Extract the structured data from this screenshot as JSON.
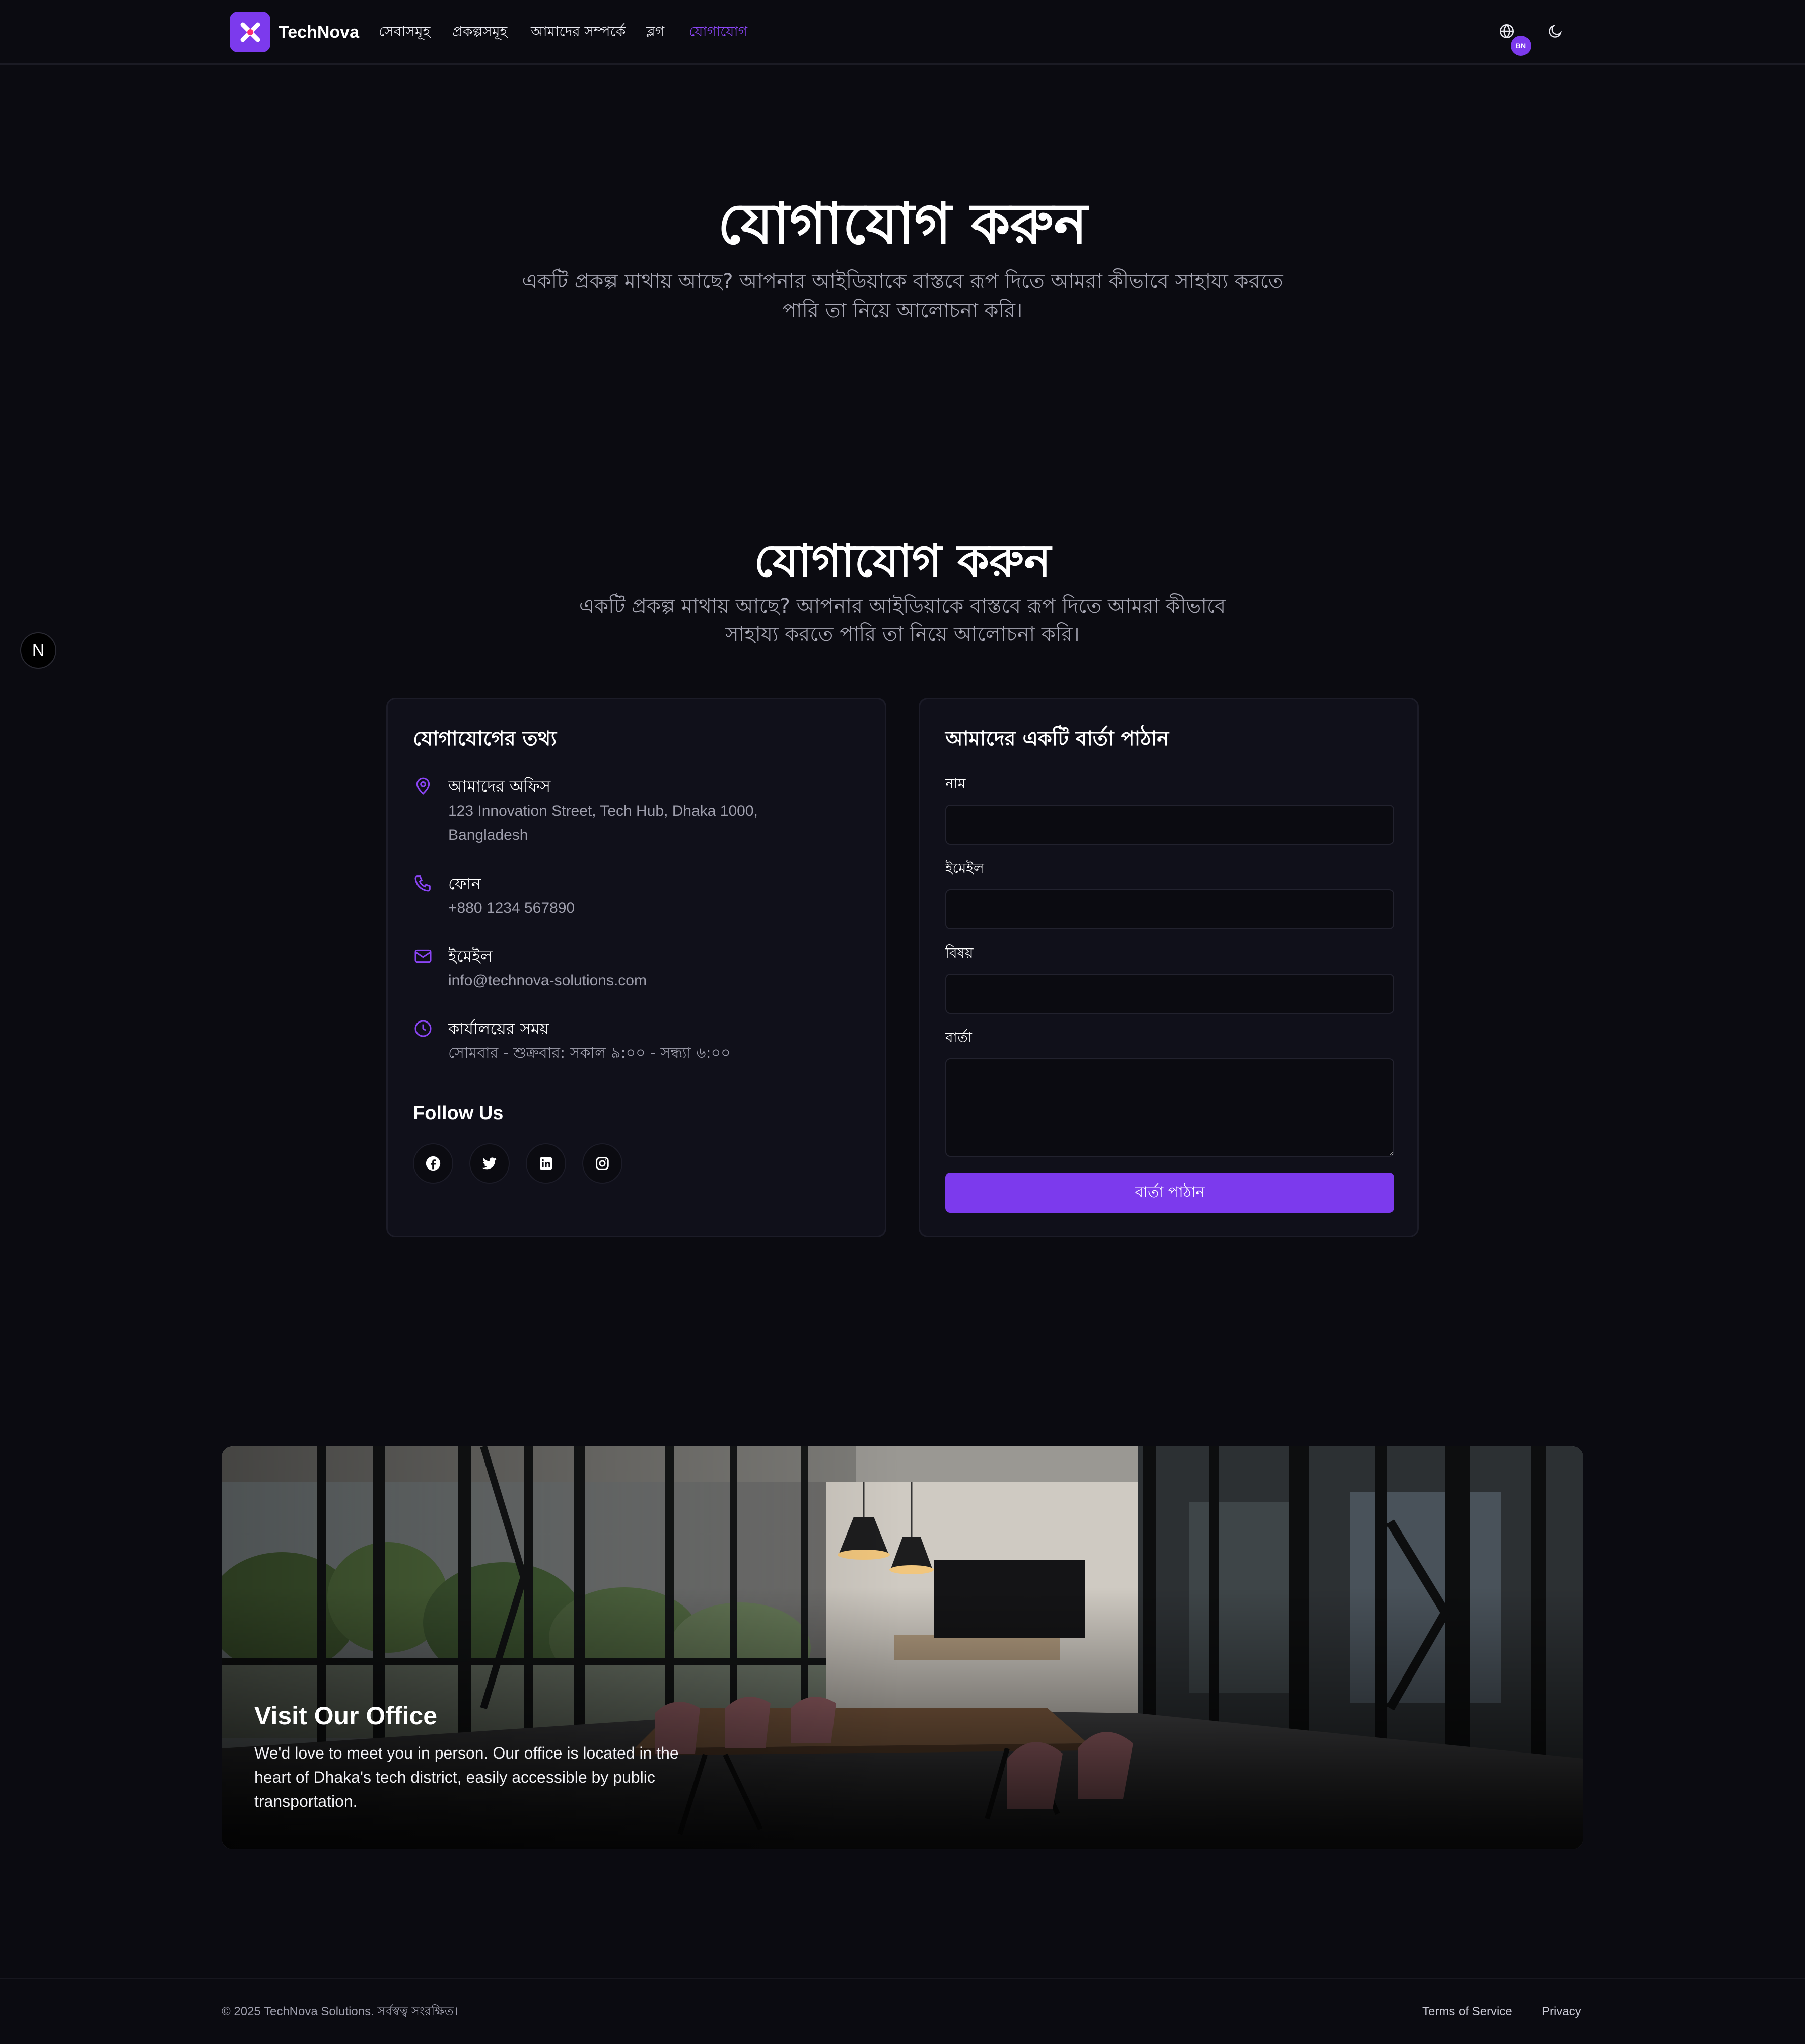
{
  "nav": {
    "brand": "TechNova",
    "links": [
      "সেবাসমূহ",
      "প্রকল্পসমূহ",
      "আমাদের সম্পর্কে",
      "ব্লগ",
      "যোগাযোগ"
    ],
    "lang_badge": "BN"
  },
  "hero": {
    "title": "যোগাযোগ করুন",
    "subtitle": "একটি প্রকল্প মাথায় আছে? আপনার আইডিয়াকে বাস্তবে রূপ দিতে আমরা কীভাবে সাহায্য করতে পারি তা নিয়ে আলোচনা করি।"
  },
  "section": {
    "title": "যোগাযোগ করুন",
    "subtitle": "একটি প্রকল্প মাথায় আছে? আপনার আইডিয়াকে বাস্তবে রূপ দিতে আমরা কীভাবে সাহায্য করতে পারি তা নিয়ে আলোচনা করি।"
  },
  "next_badge": "N",
  "contact_info": {
    "title": "যোগাযোগের তথ্য",
    "items": [
      {
        "icon": "map-pin-icon",
        "label": "আমাদের অফিস",
        "value": "123 Innovation Street, Tech Hub, Dhaka 1000, Bangladesh"
      },
      {
        "icon": "phone-icon",
        "label": "ফোন",
        "value": "+880 1234 567890"
      },
      {
        "icon": "mail-icon",
        "label": "ইমেইল",
        "value": "info@technova-solutions.com"
      },
      {
        "icon": "clock-icon",
        "label": "কার্যালয়ের সময়",
        "value": "সোমবার - শুক্রবার: সকাল ৯:০০ - সন্ধ্যা ৬:০০"
      }
    ],
    "follow_title": "Follow Us",
    "socials": [
      "facebook-icon",
      "twitter-icon",
      "linkedin-icon",
      "instagram-icon"
    ]
  },
  "form": {
    "title": "আমাদের একটি বার্তা পাঠান",
    "name_label": "নাম",
    "email_label": "ইমেইল",
    "subject_label": "বিষয়",
    "message_label": "বার্তা",
    "submit_label": "বার্তা পাঠান",
    "name_value": "",
    "email_value": "",
    "subject_value": "",
    "message_value": ""
  },
  "office": {
    "title": "Visit Our Office",
    "text": "We'd love to meet you in person. Our office is located in the heart of Dhaka's tech district, easily accessible by public transportation."
  },
  "footer": {
    "copyright": "© 2025 TechNova Solutions. সর্বস্বত্ব সংরক্ষিত।",
    "terms": "Terms of Service",
    "privacy": "Privacy"
  },
  "colors": {
    "accent": "#7c3aed",
    "background": "#0b0b11",
    "card": "#10101a"
  }
}
